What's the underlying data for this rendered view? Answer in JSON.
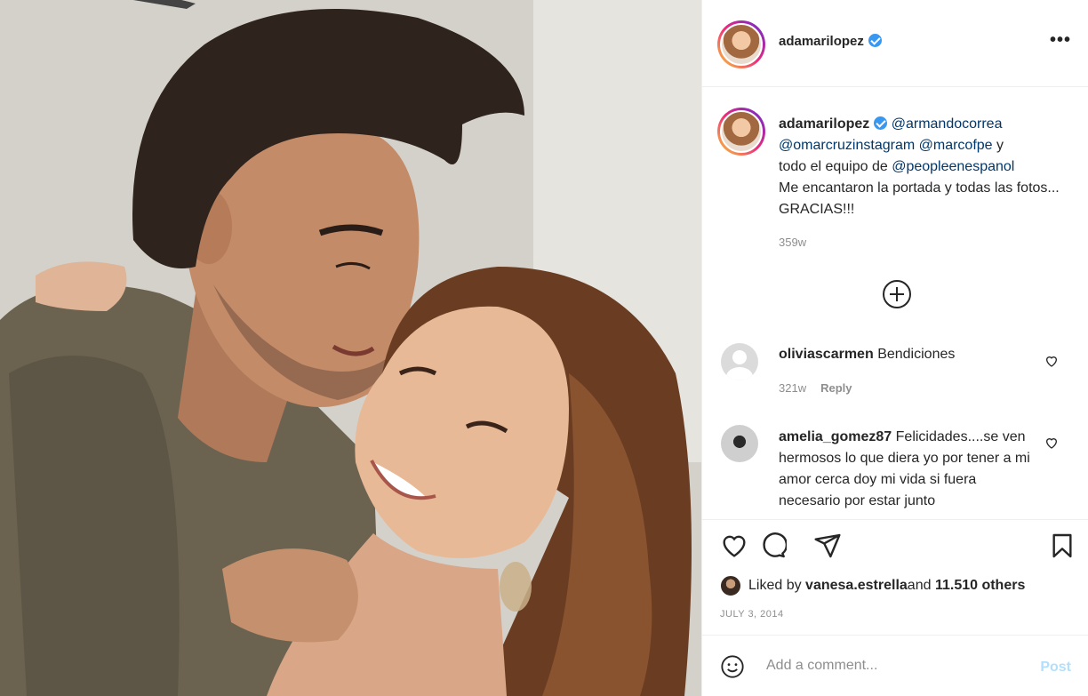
{
  "post": {
    "username": "adamarilopez",
    "more_label": "•••"
  },
  "caption": {
    "username": "adamarilopez",
    "mention_1": "@armandocorrea",
    "mention_2": "@omarcruzinstagram",
    "mention_3": "@marcofpe",
    "text_1": " y",
    "text_2": "todo el equipo de ",
    "mention_4": "@peopleenespanol",
    "text_3": "Me encantaron la portada y todas las fotos... GRACIAS!!!",
    "time": "359w"
  },
  "comments": [
    {
      "username": "oliviascarmen",
      "text": "Bendiciones",
      "time": "321w",
      "reply": "Reply"
    },
    {
      "username": "amelia_gomez87",
      "text": "Felicidades....se ven hermosos lo que diera yo por tener a mi amor cerca doy mi vida si fuera necesario por estar junto"
    }
  ],
  "likes": {
    "prefix": "Liked by ",
    "user": "vanesa.estrella",
    "middle": " and ",
    "count": "11.510 others"
  },
  "date": "JULY 3, 2014",
  "add_comment": {
    "placeholder": "Add a comment...",
    "post_label": "Post"
  },
  "colors": {
    "link": "#00376b",
    "verified": "#3897f0",
    "post_disabled": "#b2dffc",
    "muted": "#8e8e8e"
  }
}
